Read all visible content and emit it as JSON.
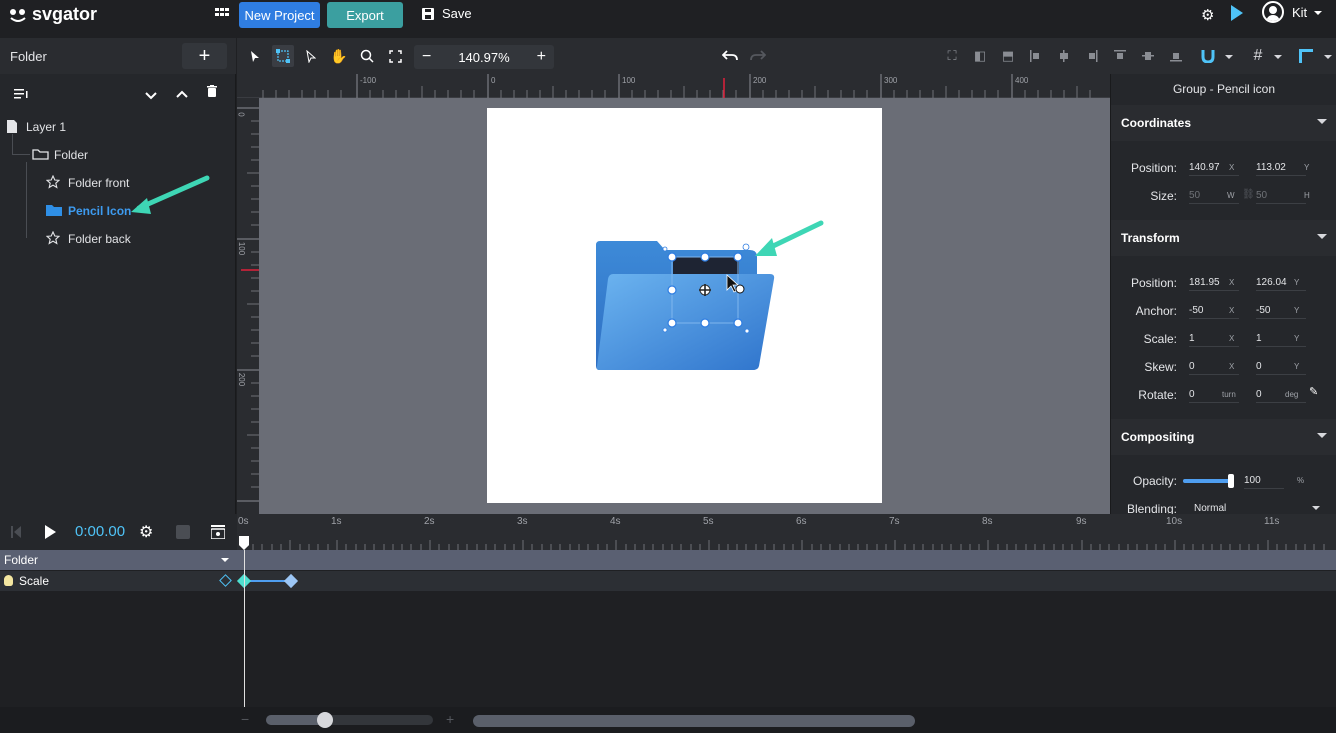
{
  "app": {
    "logo_text": "svgator",
    "new_project_label": "New Project",
    "export_label": "Export",
    "save_label": "Save",
    "user_name": "Kit",
    "brand_colors": {
      "blue": "#2f7de1",
      "teal": "#3b9fa0",
      "accent": "#4fc3f7"
    }
  },
  "layers": {
    "title": "Folder",
    "items": [
      {
        "label": "Layer 1",
        "icon": "file-icon"
      },
      {
        "label": "Folder",
        "icon": "folder-outline-icon"
      },
      {
        "label": "Folder front",
        "icon": "star-outline-icon"
      },
      {
        "label": "Pencil Icon",
        "icon": "folder-filled-icon",
        "selected": true
      },
      {
        "label": "Folder back",
        "icon": "star-outline-icon"
      }
    ]
  },
  "toolbar": {
    "zoom": "140.97%"
  },
  "ruler": {
    "top_labels": [
      "-100",
      "0",
      "100",
      "200",
      "300",
      "400"
    ],
    "left_labels": [
      "0",
      "100",
      "200"
    ]
  },
  "properties": {
    "title": "Group - Pencil icon",
    "coordinates": {
      "title": "Coordinates",
      "position_label": "Position:",
      "position_x": "140.97",
      "position_y": "113.02",
      "size_label": "Size:",
      "size_w": "50",
      "size_h": "50"
    },
    "transform": {
      "title": "Transform",
      "position_label": "Position:",
      "position_x": "181.95",
      "position_y": "126.04",
      "anchor_label": "Anchor:",
      "anchor_x": "-50",
      "anchor_y": "-50",
      "scale_label": "Scale:",
      "scale_x": "1",
      "scale_y": "1",
      "skew_label": "Skew:",
      "skew_x": "0",
      "skew_y": "0",
      "rotate_label": "Rotate:",
      "rotate_turn": "0",
      "rotate_deg": "0",
      "unit_turn": "turn",
      "unit_deg": "deg"
    },
    "compositing": {
      "title": "Compositing",
      "opacity_label": "Opacity:",
      "opacity_value": "100",
      "opacity_fraction": 1.0,
      "opacity_unit": "%",
      "blending_label": "Blending:",
      "blending_value": "Normal"
    },
    "unit_x": "X",
    "unit_y": "Y",
    "unit_w": "W",
    "unit_h": "H"
  },
  "timeline": {
    "time": "0:00.00",
    "ticks": [
      "0s",
      "1s",
      "2s",
      "3s",
      "4s",
      "5s",
      "6s",
      "7s",
      "8s",
      "9s",
      "10s",
      "11s"
    ],
    "tracks": [
      {
        "label": "Folder"
      },
      {
        "label": "Scale"
      }
    ]
  }
}
